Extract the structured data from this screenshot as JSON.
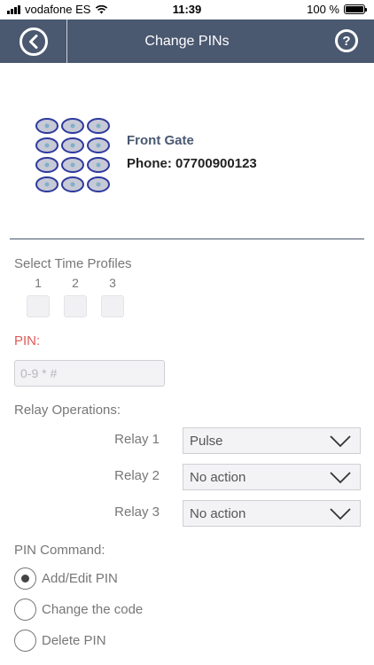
{
  "status_bar": {
    "carrier": "vodafone ES",
    "time": "11:39",
    "battery": "100 %"
  },
  "header": {
    "title": "Change PINs"
  },
  "device": {
    "name": "Front Gate",
    "phone": "Phone: 07700900123"
  },
  "time_profiles": {
    "label": "Select Time Profiles",
    "items": [
      "1",
      "2",
      "3"
    ]
  },
  "pin": {
    "label": "PIN:",
    "placeholder": "0-9 * #",
    "value": ""
  },
  "relay_operations": {
    "label": "Relay Operations:",
    "relays": [
      {
        "label": "Relay 1",
        "value": "Pulse"
      },
      {
        "label": "Relay 2",
        "value": "No action"
      },
      {
        "label": "Relay 3",
        "value": "No action"
      }
    ]
  },
  "pin_command": {
    "label": "PIN Command:",
    "options": [
      {
        "label": "Add/Edit PIN",
        "selected": true
      },
      {
        "label": "Change the code",
        "selected": false
      },
      {
        "label": "Delete PIN",
        "selected": false
      }
    ]
  },
  "colors": {
    "header_bg": "#4a5870",
    "pin_label": "#e05a5a",
    "keypad_key": "#2e3a9e"
  }
}
